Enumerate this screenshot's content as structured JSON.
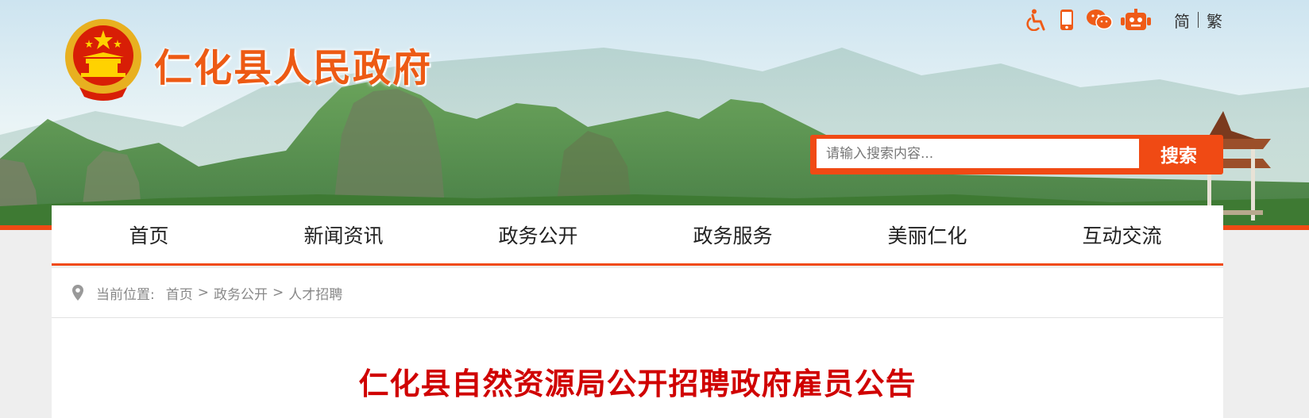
{
  "site": {
    "title": "仁化县人民政府"
  },
  "tools": {
    "icons": [
      "accessibility-icon",
      "mobile-icon",
      "wechat-icon",
      "robot-icon"
    ],
    "lang_simplified": "简",
    "lang_traditional": "繁"
  },
  "search": {
    "placeholder": "请输入搜索内容...",
    "button_label": "搜索"
  },
  "nav": {
    "items": [
      {
        "label": "首页"
      },
      {
        "label": "新闻资讯"
      },
      {
        "label": "政务公开"
      },
      {
        "label": "政务服务"
      },
      {
        "label": "美丽仁化"
      },
      {
        "label": "互动交流"
      }
    ]
  },
  "breadcrumb": {
    "label": "当前位置:",
    "items": [
      "首页",
      "政务公开",
      "人才招聘"
    ],
    "separator": ">"
  },
  "article": {
    "title": "仁化县自然资源局公开招聘政府雇员公告"
  },
  "colors": {
    "accent": "#f04a14",
    "title_red": "#d00000",
    "site_title": "#ed5a14"
  }
}
